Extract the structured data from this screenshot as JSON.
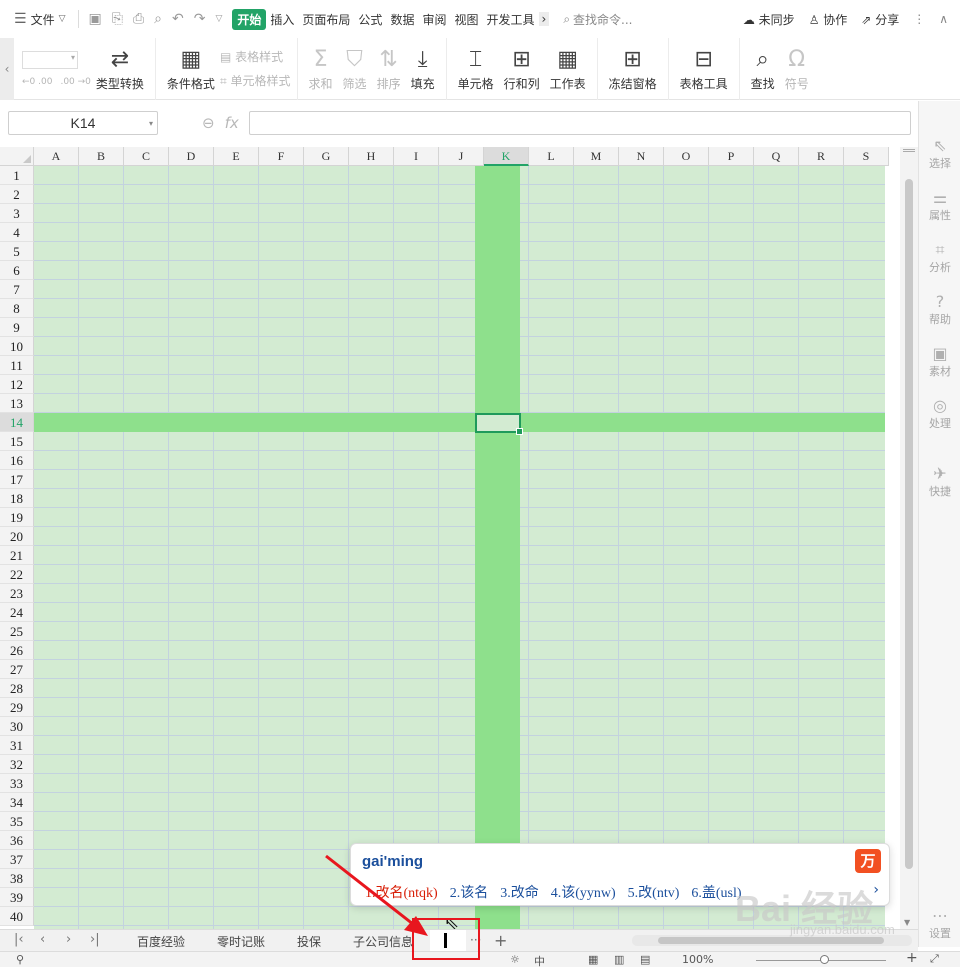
{
  "menubar": {
    "hamburger_icon": "menu-icon",
    "file": "文件",
    "quick_access": [
      "save-icon",
      "export-icon",
      "print-icon",
      "preview-icon",
      "undo-icon",
      "redo-icon"
    ],
    "tabs": [
      "开始",
      "插入",
      "页面布局",
      "公式",
      "数据",
      "审阅",
      "视图",
      "开发工具"
    ],
    "search_placeholder": "查找命令...",
    "sync": "未同步",
    "collab": "协作",
    "share": "分享"
  },
  "ribbon": {
    "type_convert": "类型转换",
    "cond_format": "条件格式",
    "table_style": "表格样式",
    "cell_style": "单元格样式",
    "sum": "求和",
    "filter": "筛选",
    "sort": "排序",
    "fill": "填充",
    "cell": "单元格",
    "row_col": "行和列",
    "worksheet": "工作表",
    "freeze": "冻结窗格",
    "table_tools": "表格工具",
    "find": "查找",
    "symbol": "符号",
    "dec_inc": "←0 .00",
    "dec_dec": ".00 →0"
  },
  "formula_bar": {
    "name_box": "K14",
    "fx": "fx",
    "formula": ""
  },
  "grid": {
    "columns": [
      "A",
      "B",
      "C",
      "D",
      "E",
      "F",
      "G",
      "H",
      "I",
      "J",
      "K",
      "L",
      "M",
      "N",
      "O",
      "P",
      "Q",
      "R",
      "S"
    ],
    "rows": [
      "1",
      "2",
      "3",
      "4",
      "5",
      "6",
      "7",
      "8",
      "9",
      "10",
      "11",
      "12",
      "13",
      "14",
      "15",
      "16",
      "17",
      "18",
      "19",
      "20",
      "21",
      "22",
      "23",
      "24",
      "25",
      "26",
      "27",
      "28",
      "29",
      "30",
      "31",
      "32",
      "33",
      "34",
      "35",
      "36",
      "37",
      "38",
      "39",
      "40"
    ],
    "active_column": "K",
    "active_row": "14"
  },
  "right_panel": [
    {
      "label": "选择",
      "icon": "select-icon"
    },
    {
      "label": "属性",
      "icon": "properties-icon"
    },
    {
      "label": "分析",
      "icon": "analysis-icon"
    },
    {
      "label": "帮助",
      "icon": "help-icon"
    },
    {
      "label": "素材",
      "icon": "assets-icon"
    },
    {
      "label": "处理",
      "icon": "process-icon"
    },
    {
      "label": "快捷",
      "icon": "shortcut-icon"
    },
    {
      "label": "设置",
      "icon": "settings-icon"
    }
  ],
  "ime": {
    "input": "gai'ming",
    "candidates": [
      "1.改名(ntqk)",
      "2.该名",
      "3.改命",
      "4.该(yynw)",
      "5.改(ntv)",
      "6.盖(usl)"
    ]
  },
  "sheet_tabs": [
    "百度经验",
    "零时记账",
    "投保",
    "子公司信息"
  ],
  "sheet_more": "···",
  "sheet_add": "+",
  "status": {
    "zoom": "100%"
  },
  "watermark": {
    "brand": "Bai 经验",
    "url": "jingyan.baidu.com"
  },
  "colors": {
    "accent": "#22a367",
    "highlight": "#8ee08c",
    "cell_bg": "#d3ebd2",
    "annotation": "#e8161e"
  }
}
